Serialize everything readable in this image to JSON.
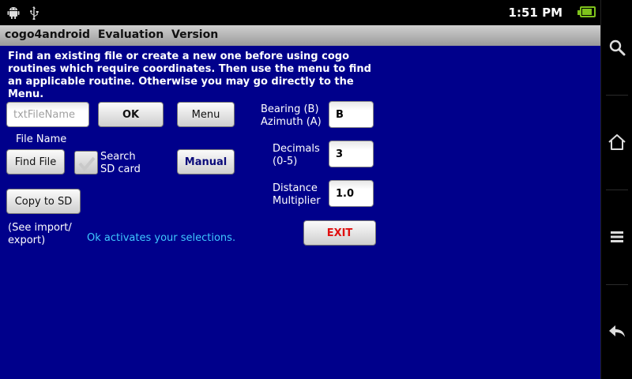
{
  "status_bar": {
    "time": "1:51 PM",
    "left_icons": [
      "android-debug-icon",
      "usb-icon"
    ],
    "battery_color": "#7fc31c",
    "battery_level_fraction": 0.85
  },
  "title_bar": {
    "title": "cogo4android  Evaluation  Version"
  },
  "main": {
    "background_color": "#00008b",
    "intro_text": "Find an existing file or create a new one before using cogo routines which require coordinates. Then use the menu to find an applicable routine. Otherwise you may go directly to the Menu.",
    "file_name_input": {
      "placeholder": "txtFileName",
      "value": ""
    },
    "file_name_label": "File Name",
    "ok_button": "OK",
    "menu_button": "Menu",
    "find_file_button": "Find File",
    "search_sd_label_line1": "Search",
    "search_sd_label_line2": "SD card",
    "search_sd_checked": true,
    "manual_button": "Manual",
    "copy_to_sd_button": "Copy to SD",
    "see_import_line1": "(See import/",
    "see_import_line2": "export)",
    "hint_text": "Ok activates your selections.",
    "bearing_label_line1": "Bearing (B)",
    "bearing_label_line2": "Azimuth (A)",
    "bearing_value": "B",
    "decimals_label_line1": "Decimals",
    "decimals_label_line2": "(0-5)",
    "decimals_value": "3",
    "distance_label_line1": "Distance",
    "distance_label_line2": "Multiplier",
    "distance_value": "1.0",
    "exit_button": "EXIT",
    "exit_color": "#e01010",
    "manual_color": "#0a0a7a",
    "hint_color": "#3fc8ff"
  },
  "nav_bar": {
    "items": [
      "search-icon",
      "home-icon",
      "menu-icon",
      "back-icon"
    ]
  }
}
